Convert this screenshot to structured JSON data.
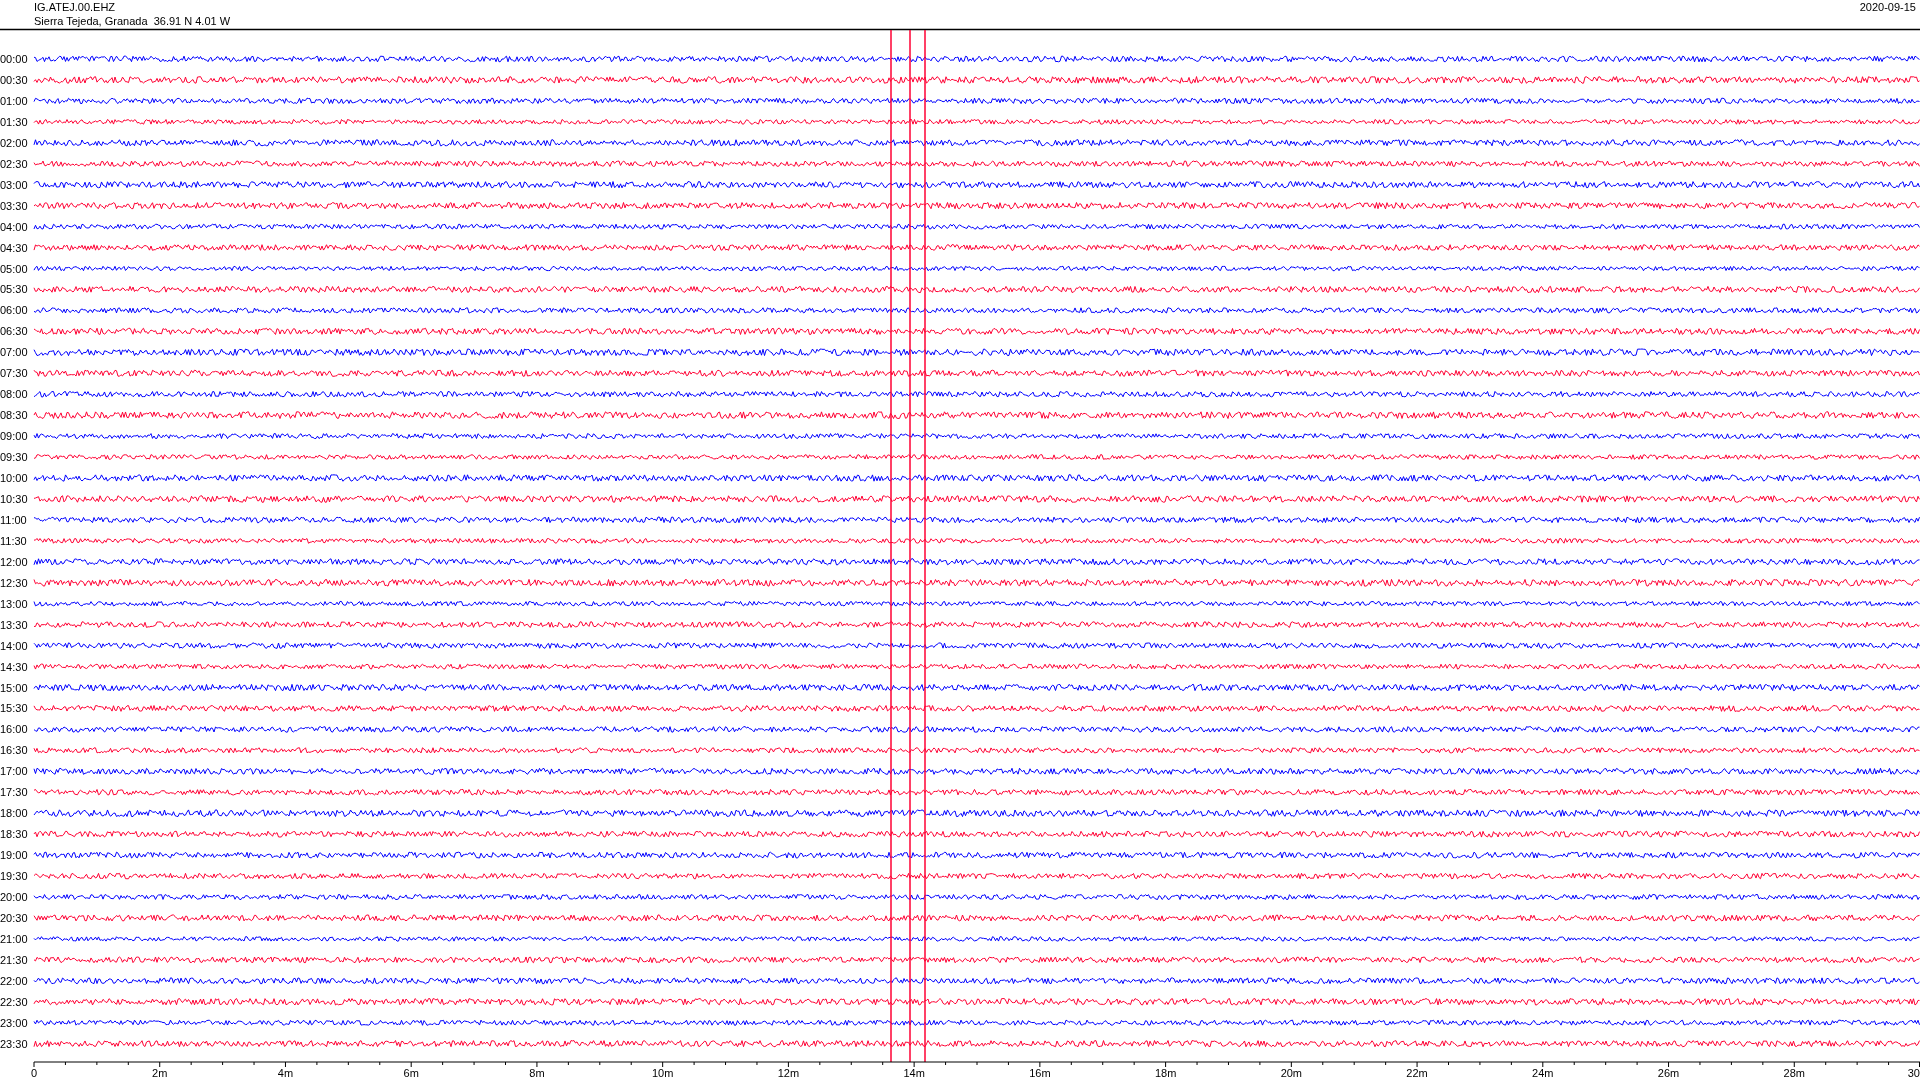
{
  "header": {
    "station": "IG.ATEJ.00.EHZ",
    "location": "Sierra Tejeda, Granada  36.91 N 4.01 W",
    "date": "2020-09-15"
  },
  "traces": [
    {
      "label": "00:00",
      "color": "#0000ff"
    },
    {
      "label": "00:30",
      "color": "#ff0033"
    },
    {
      "label": "01:00",
      "color": "#0000ff"
    },
    {
      "label": "01:30",
      "color": "#ff0033"
    },
    {
      "label": "02:00",
      "color": "#0000ff"
    },
    {
      "label": "02:30",
      "color": "#ff0033"
    },
    {
      "label": "03:00",
      "color": "#0000ff"
    },
    {
      "label": "03:30",
      "color": "#ff0033"
    },
    {
      "label": "04:00",
      "color": "#0000ff"
    },
    {
      "label": "04:30",
      "color": "#ff0033"
    },
    {
      "label": "05:00",
      "color": "#0000ff"
    },
    {
      "label": "05:30",
      "color": "#ff0033"
    },
    {
      "label": "06:00",
      "color": "#0000ff"
    },
    {
      "label": "06:30",
      "color": "#ff0033"
    },
    {
      "label": "07:00",
      "color": "#0000ff"
    },
    {
      "label": "07:30",
      "color": "#ff0033"
    },
    {
      "label": "08:00",
      "color": "#0000ff"
    },
    {
      "label": "08:30",
      "color": "#ff0033"
    },
    {
      "label": "09:00",
      "color": "#0000ff"
    },
    {
      "label": "09:30",
      "color": "#ff0033"
    },
    {
      "label": "10:00",
      "color": "#0000ff"
    },
    {
      "label": "10:30",
      "color": "#ff0033"
    },
    {
      "label": "11:00",
      "color": "#0000ff"
    },
    {
      "label": "11:30",
      "color": "#ff0033"
    },
    {
      "label": "12:00",
      "color": "#0000ff"
    },
    {
      "label": "12:30",
      "color": "#ff0033"
    },
    {
      "label": "13:00",
      "color": "#0000ff"
    },
    {
      "label": "13:30",
      "color": "#ff0033"
    },
    {
      "label": "14:00",
      "color": "#0000ff"
    },
    {
      "label": "14:30",
      "color": "#ff0033"
    },
    {
      "label": "15:00",
      "color": "#0000ff"
    },
    {
      "label": "15:30",
      "color": "#ff0033"
    },
    {
      "label": "16:00",
      "color": "#0000ff"
    },
    {
      "label": "16:30",
      "color": "#ff0033"
    },
    {
      "label": "17:00",
      "color": "#0000ff"
    },
    {
      "label": "17:30",
      "color": "#ff0033"
    },
    {
      "label": "18:00",
      "color": "#0000ff"
    },
    {
      "label": "18:30",
      "color": "#ff0033"
    },
    {
      "label": "19:00",
      "color": "#0000ff"
    },
    {
      "label": "19:30",
      "color": "#ff0033"
    },
    {
      "label": "20:00",
      "color": "#0000ff"
    },
    {
      "label": "20:30",
      "color": "#ff0033"
    },
    {
      "label": "21:00",
      "color": "#0000ff"
    },
    {
      "label": "21:30",
      "color": "#ff0033"
    },
    {
      "label": "22:00",
      "color": "#0000ff"
    },
    {
      "label": "22:30",
      "color": "#ff0033"
    },
    {
      "label": "23:00",
      "color": "#0000ff"
    },
    {
      "label": "23:30",
      "color": "#ff0033"
    }
  ],
  "x_axis": {
    "labels": [
      "0",
      "2m",
      "4m",
      "6m",
      "8m",
      "10m",
      "12m",
      "14m",
      "16m",
      "18m",
      "20m",
      "22m",
      "24m",
      "26m",
      "28m",
      "30"
    ]
  }
}
